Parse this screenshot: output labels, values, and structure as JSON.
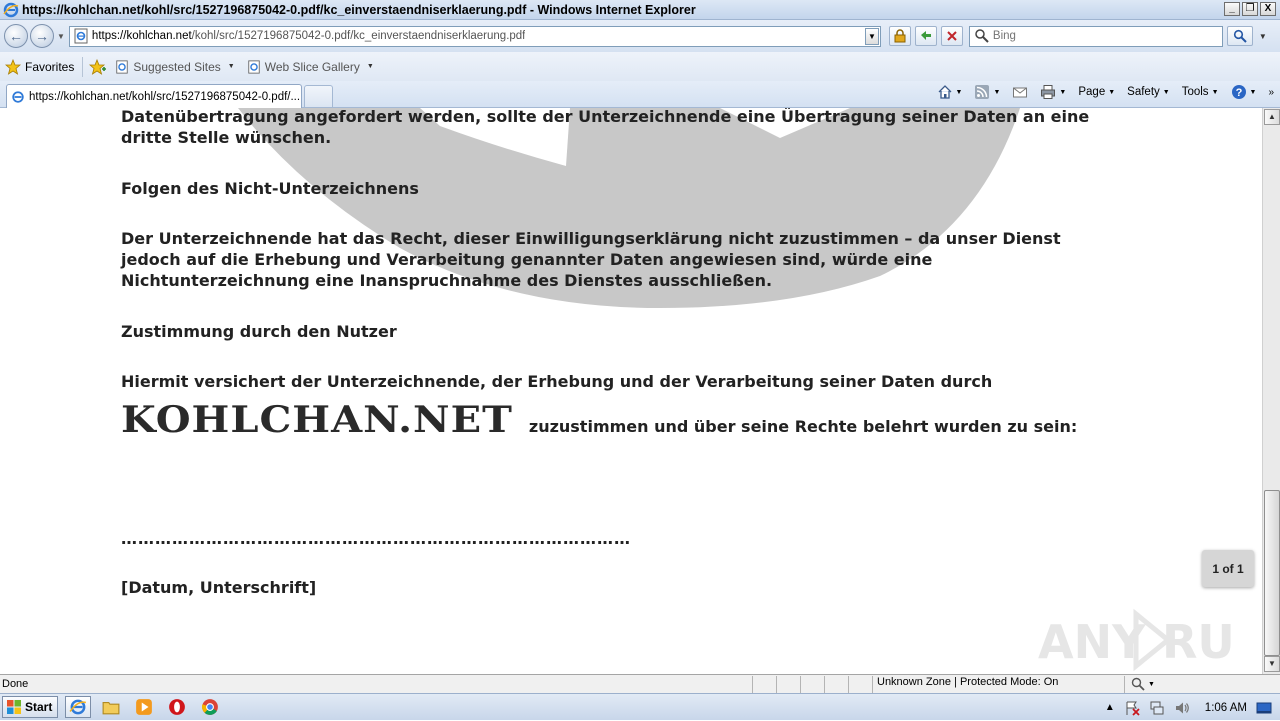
{
  "window": {
    "title": "https://kohlchan.net/kohl/src/1527196875042-0.pdf/kc_einverstaendniserklaerung.pdf - Windows Internet Explorer",
    "minimize": "_",
    "restore": "❐",
    "close": "X"
  },
  "address": {
    "host": "https://kohlchan.net",
    "path": "/kohl/src/1527196875042-0.pdf/kc_einverstaendniserklaerung.pdf"
  },
  "search": {
    "placeholder": "Bing"
  },
  "favorites_bar": {
    "favorites_label": "Favorites",
    "suggested_sites": "Suggested Sites",
    "web_slice_gallery": "Web Slice Gallery"
  },
  "tab": {
    "title": "https://kohlchan.net/kohl/src/1527196875042-0.pdf/..."
  },
  "command_bar": {
    "page": "Page",
    "safety": "Safety",
    "tools": "Tools"
  },
  "document": {
    "line1": "Datenübertragung angefordert werden, sollte der Unterzeichnende eine Übertragung seiner Daten an eine",
    "line2": "dritte Stelle wünschen.",
    "heading1": "Folgen des Nicht-Unterzeichnens",
    "para1_l1": "Der Unterzeichnende hat das Recht, dieser Einwilligungserklärung nicht zuzustimmen – da unser Dienst",
    "para1_l2": "jedoch auf die Erhebung und Verarbeitung genannter Daten angewiesen sind, würde eine",
    "para1_l3": "Nichtunterzeichnung eine Inanspruchnahme des Dienstes ausschließen.",
    "heading2": "Zustimmung durch den Nutzer",
    "para2_l1": "Hiermit versichert der Unterzeichnende, der Erhebung und der Verarbeitung seiner Daten durch",
    "logo_text": "KOHLCHAN.NET",
    "para2_rest": "zuzustimmen und über seine Rechte belehrt wurden zu sein:",
    "signature_line": "………………………………………………………………………………",
    "signature_label": "[Datum, Unterschrift]"
  },
  "page_indicator": "1 of 1",
  "watermark_text": "ANY RUN",
  "status": {
    "left": "Done",
    "zone": "Unknown Zone | Protected Mode: On"
  },
  "taskbar": {
    "start": "Start",
    "clock": "1:06 AM"
  }
}
